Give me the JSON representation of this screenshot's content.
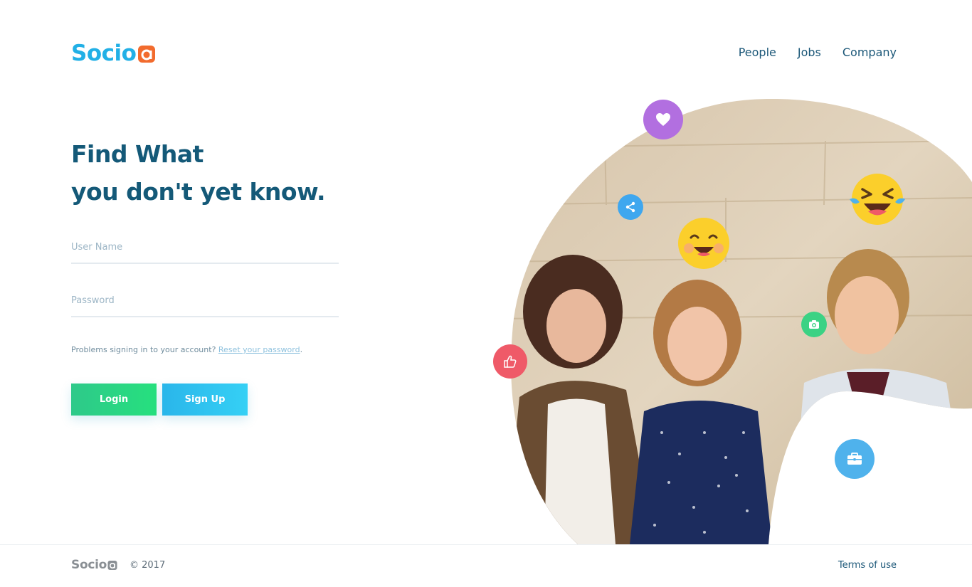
{
  "brand": {
    "name": "Socio",
    "accent_blue": "#22b0e6",
    "accent_orange": "#f26b2d"
  },
  "nav": {
    "items": [
      {
        "label": "People"
      },
      {
        "label": "Jobs"
      },
      {
        "label": "Company"
      }
    ]
  },
  "hero": {
    "headline_line1": "Find What",
    "headline_line2": "you don't yet know."
  },
  "form": {
    "username_placeholder": "User Name",
    "password_placeholder": "Password",
    "problems_text": "Problems signing in to your account? ",
    "reset_link": "Reset your password",
    "reset_suffix": ".",
    "login_label": "Login",
    "signup_label": "Sign Up"
  },
  "icons": [
    "heart-icon",
    "share-icon",
    "camera-icon",
    "thumbs-up-icon",
    "briefcase-icon",
    "smiling-emoji",
    "laughing-emoji"
  ],
  "colors": {
    "heart": "#b26fe0",
    "share": "#3fa7ef",
    "camera": "#3bd284",
    "like": "#ef5a68",
    "briefcase": "#4fb2ec",
    "login_button": "#2ec98a",
    "signup_button": "#2ab6ea",
    "headline": "#145978"
  },
  "footer": {
    "logo": "Socio",
    "copyright": "© 2017",
    "terms_label": "Terms of use"
  }
}
